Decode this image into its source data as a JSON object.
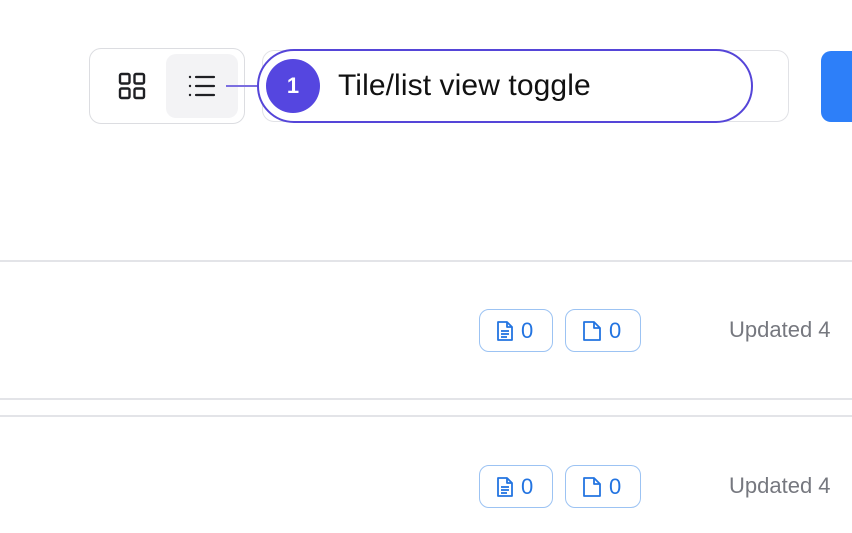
{
  "toolbar": {
    "view_toggle": {
      "tile_icon": "grid-icon",
      "list_icon": "list-icon",
      "active": "list"
    }
  },
  "callout": {
    "number": "1",
    "text": "Tile/list view toggle"
  },
  "rows": [
    {
      "docs_count": "0",
      "files_count": "0",
      "updated": "Updated 4"
    },
    {
      "docs_count": "0",
      "files_count": "0",
      "updated": "Updated 4"
    }
  ],
  "colors": {
    "accent_purple": "#5546e0",
    "primary_blue": "#2d7ff9",
    "chip_text": "#2374e1",
    "chip_border": "#9cc3f3"
  }
}
